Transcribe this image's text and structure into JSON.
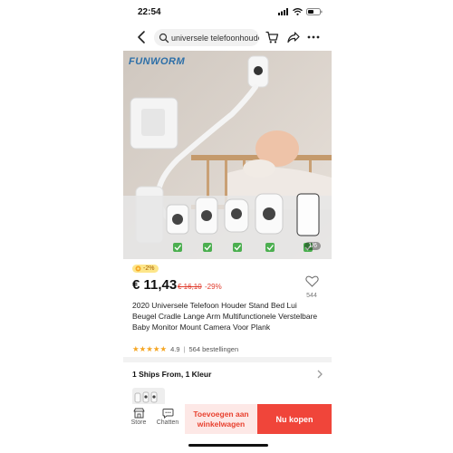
{
  "status_bar": {
    "time": "22:54"
  },
  "search": {
    "value": "universele telefoonhouder"
  },
  "gallery": {
    "brand": "FUNWORM",
    "counter": "1/6"
  },
  "product": {
    "badge": "-2%",
    "price": "€ 11,43",
    "old_price": "€ 16,10",
    "discount": "-29%",
    "wishlist_count": "544",
    "title": "2020 Universele Telefoon Houder Stand Bed Lui Beugel Cradle Lange Arm Multifunctionele Verstelbare Baby Monitor Mount Camera Voor Plank",
    "rating": "4.9",
    "orders": "564 bestellingen"
  },
  "shipping": {
    "label": "1 Ships From, 1 Kleur"
  },
  "bottom_bar": {
    "store_label": "Store",
    "chat_label": "Chatten",
    "cart_line1": "Toevoegen aan",
    "cart_line2": "winkelwagen",
    "buy_label": "Nu kopen"
  },
  "colors": {
    "accent": "#f0453a",
    "cart_bg": "#fde8e6",
    "star": "#f5a623",
    "price_red": "#e03b2c"
  },
  "icons": [
    "back-icon",
    "search-icon",
    "cart-icon",
    "share-icon",
    "more-icon",
    "heart-icon",
    "chevron-right-icon",
    "store-icon",
    "chat-icon",
    "check-icon"
  ]
}
